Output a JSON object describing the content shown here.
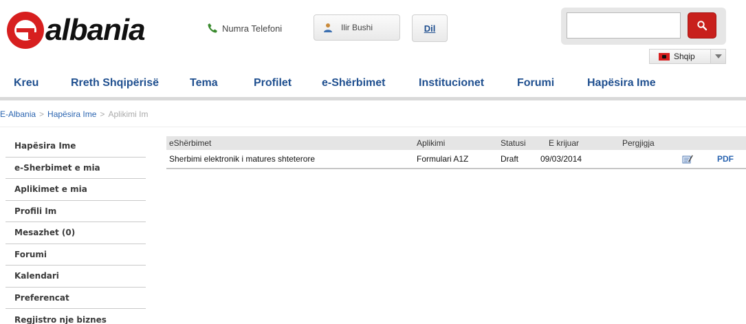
{
  "header": {
    "logo_text": "albania",
    "phone_label": "Numra Telefoni",
    "user_name": "Ilir Bushi",
    "lang_button": "Dil",
    "search": {
      "value": "",
      "placeholder": ""
    },
    "language": {
      "selected": "Shqip"
    }
  },
  "nav": {
    "items": [
      {
        "label": "Kreu"
      },
      {
        "label": "Rreth Shqipërisë"
      },
      {
        "label": "Tema"
      },
      {
        "label": "Profilet"
      },
      {
        "label": "e-Shërbimet"
      },
      {
        "label": "Institucionet"
      },
      {
        "label": "Forumi"
      },
      {
        "label": "Hapësira Ime"
      }
    ]
  },
  "breadcrumb": {
    "items": [
      "E-Albania",
      "Hapësira Ime",
      "Aplikimi Im"
    ],
    "separator": ">"
  },
  "sidebar": {
    "items": [
      {
        "label": "Hapësira Ime"
      },
      {
        "label": "e-Sherbimet e mia"
      },
      {
        "label": "Aplikimet e mia"
      },
      {
        "label": "Profili Im"
      },
      {
        "label": "Mesazhet (0)"
      },
      {
        "label": "Forumi"
      },
      {
        "label": "Kalendari"
      },
      {
        "label": "Preferencat"
      },
      {
        "label": "Regjistro nje biznes"
      }
    ]
  },
  "table": {
    "columns": [
      "eShërbimet",
      "Aplikimi",
      "Statusi",
      "E krijuar",
      "Pergjigja"
    ],
    "rows": [
      {
        "service": "Sherbimi elektronik i matures shteterore",
        "application": "Formulari A1Z",
        "status": "Draft",
        "created": "09/03/2014",
        "response": "",
        "edit_icon": "edit-icon",
        "pdf_label": "PDF"
      }
    ]
  },
  "colors": {
    "brand_red": "#d71f1f",
    "link_blue": "#1f4f8f"
  }
}
